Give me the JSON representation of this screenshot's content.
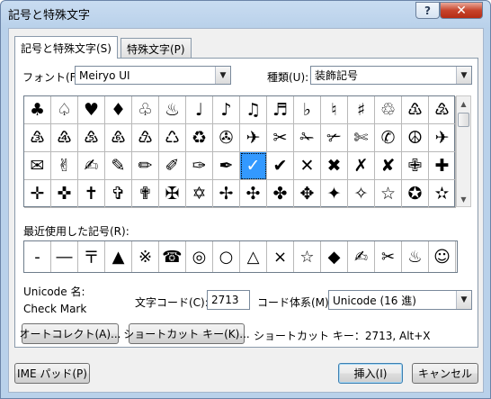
{
  "window": {
    "title": "記号と特殊文字"
  },
  "titlebar": {
    "help": "?",
    "close": "✕"
  },
  "tabs": [
    {
      "label": "記号と特殊文字(S)"
    },
    {
      "label": "特殊文字(P)"
    }
  ],
  "font": {
    "label": "フォント(F):",
    "value": "Meiryo UI"
  },
  "subset": {
    "label": "種類(U):",
    "value": "装飾記号"
  },
  "symbols": [
    "♣",
    "♤",
    "♥",
    "♦",
    "♧",
    "♨",
    "♩",
    "♪",
    "♫",
    "♬",
    "♭",
    "♮",
    "♯",
    "♲",
    "♳",
    "♴",
    "♵",
    "♶",
    "♷",
    "♸",
    "♹",
    "♺",
    "♻",
    "✇",
    "✈",
    "✂",
    "✁",
    "✃",
    "✄",
    "✆",
    "☮",
    "✈",
    "✉",
    "✌",
    "✍",
    "✎",
    "✏",
    "✐",
    "✑",
    "✒",
    "✓",
    "✔",
    "✕",
    "✖",
    "✗",
    "✘",
    "✙",
    "✚",
    "✛",
    "✜",
    "✝",
    "✞",
    "✟",
    "✠",
    "✡",
    "✢",
    "✣",
    "✤",
    "✥",
    "✦",
    "✧",
    "☆",
    "✪",
    "✫"
  ],
  "selected_index": 40,
  "recent": {
    "label": "最近使用した記号(R):",
    "items": [
      "‐",
      "―",
      "〒",
      "▲",
      "※",
      "☎",
      "◎",
      "○",
      "△",
      "×",
      "☆",
      "◆",
      "✍",
      "✂",
      "♨",
      "☺"
    ]
  },
  "unicode_name": {
    "label": "Unicode 名:",
    "value": "Check Mark"
  },
  "char_code": {
    "label": "文字コード(C):",
    "value": "2713"
  },
  "code_system": {
    "label": "コード体系(M):",
    "value": "Unicode (16 進)"
  },
  "buttons": {
    "autocorrect": "オートコレクト(A)...",
    "shortcut": "ショートカット キー(K)...",
    "ime": "IME パッド(P)",
    "insert": "挿入(I)",
    "cancel": "キャンセル"
  },
  "shortcut_info": "ショートカット キー：2713, Alt+X"
}
